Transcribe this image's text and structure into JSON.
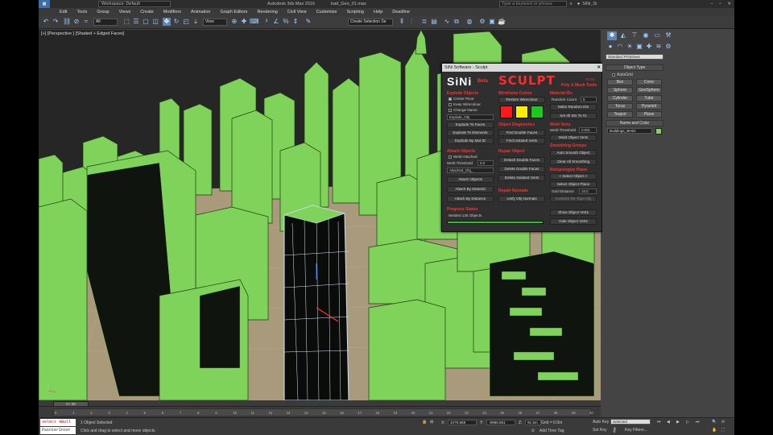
{
  "app": {
    "title": "Autodesk 3ds Max 2016",
    "file": "bad_Geo_01.max",
    "workspace": "Workspace: Default",
    "search_placeholder": "Type a keyword or phrase",
    "user": "SiNi_Si"
  },
  "menu": [
    "Edit",
    "Tools",
    "Group",
    "Views",
    "Create",
    "Modifiers",
    "Animation",
    "Graph Editors",
    "Rendering",
    "Civil View",
    "Customize",
    "Scripting",
    "Help",
    "Deadline"
  ],
  "toolbar": {
    "selection_filter": "All",
    "ref_coord": "View",
    "named_selection": "Create Selection Se"
  },
  "viewport": {
    "label": "[+] [Perspective ] [Shaded + Edged Faces]"
  },
  "sculpt": {
    "title": "SiNi Software - Sculpt",
    "logo": "SiNi",
    "beta": "Beta",
    "name": "SCULPT",
    "version": "V1.01",
    "subtitle": "Poly & Mesh Tools",
    "explode": {
      "header": "Explode Objects",
      "options": [
        "Center Pivot",
        "Keep Wirecolour",
        "Change Name"
      ],
      "name_value": "Explode_Obj",
      "buttons": [
        "Explode To Faces",
        "Explode To Elements",
        "Explode By Mat ID"
      ]
    },
    "attach": {
      "header": "Attach Objects",
      "weld_attached": "Weld Attached",
      "weld_threshold_label": "Weld Threshold",
      "weld_threshold_value": "0.0",
      "name_value": "Attached_Obj_",
      "buttons": [
        "Attach Objects",
        "Attach By Material",
        "Attach By Distance"
      ]
    },
    "progress": {
      "header": "Progress Status",
      "text": "Welded 125 Objects",
      "percent": 100
    },
    "wire": {
      "header": "Wireframe Colour",
      "restore": "Restore Wirecolour",
      "swatches": [
        "#ff1a1a",
        "#ffee00",
        "#1ec81e"
      ]
    },
    "diagnostics": {
      "header": "Object Diagnostics",
      "buttons": [
        "Find Double Faces",
        "Find Isolated Verts"
      ]
    },
    "repair": {
      "header": "Repair Object",
      "buttons": [
        "Detach Double Faces",
        "Delete Double Faces",
        "Delete Isolated Verts"
      ]
    },
    "normals": {
      "header": "Repair Normals",
      "unify": "Unify Obj Normals"
    },
    "material": {
      "header": "Material IDs",
      "random_label": "Random Count",
      "random_value": "8",
      "buttons": [
        "Make Random IDs",
        "Set All IDs To #1"
      ]
    },
    "weld": {
      "header": "Weld Verts",
      "threshold_label": "Weld Threshold",
      "threshold_value": "0.001",
      "button": "Weld Object Verts"
    },
    "smoothing": {
      "header": "Smoothing Groups",
      "buttons": [
        "Auto Smooth Object",
        "Clear All Smoothing"
      ]
    },
    "retopo": {
      "header": "Retopologize Plane",
      "select": "< Select Object >",
      "button": "Select Object Plane",
      "grid_label": "Grid Distance",
      "grid_value": "10.0",
      "conform": "Conform Re-Topo Obj"
    },
    "visibility": {
      "buttons": [
        "Show Object Verts",
        "Hide Object Verts"
      ]
    }
  },
  "command_panel": {
    "dropdown": "Standard Primitives",
    "object_type": "Object Type",
    "autogrid": "AutoGrid",
    "primitives": [
      "Box",
      "Cone",
      "Sphere",
      "GeoSphere",
      "Cylinder",
      "Tube",
      "Torus",
      "Pyramid",
      "Teapot",
      "Plane"
    ],
    "name_color": "Name and Color",
    "object_name": "Buildings_BH01"
  },
  "timeline": {
    "frame": "0 / 30",
    "ticks": [
      "0",
      "1",
      "2",
      "3",
      "4",
      "5",
      "6",
      "7",
      "8",
      "9",
      "10",
      "11",
      "12",
      "13",
      "14",
      "15",
      "16",
      "17",
      "18",
      "19",
      "20",
      "21",
      "22",
      "23",
      "24",
      "25",
      "26",
      "27",
      "28",
      "29",
      "30"
    ]
  },
  "status": {
    "script1": "select 4Bull",
    "script2": "PainterInter",
    "selected": "1 Object Selected",
    "prompt": "Click and drag to select and move objects",
    "x": "4275.569",
    "y": "-8986.851",
    "z": "91.5m",
    "grid": "Grid = 0.0m",
    "add_time_tag": "Add Time Tag",
    "auto_key": "Auto Key",
    "set_key": "Set Key",
    "key_mode": "Selected",
    "key_filters": "Key Filters..."
  },
  "colors": {
    "building": "#7fd35a",
    "building_dark": "#101510",
    "ground": "#a89a7a",
    "accent_red": "#ff2b2b"
  }
}
